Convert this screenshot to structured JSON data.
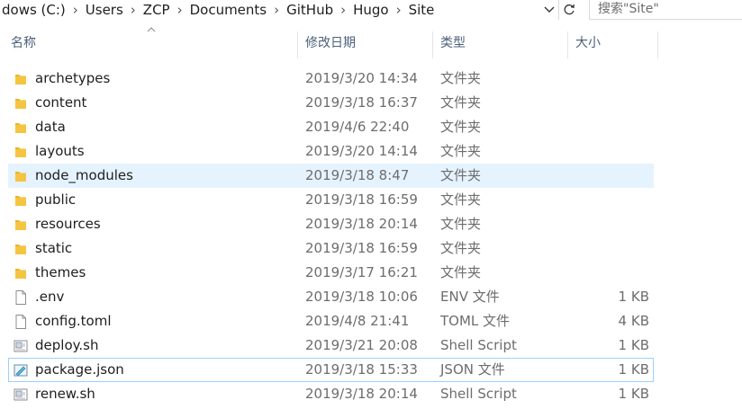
{
  "address": {
    "crumbs": [
      "dows (C:)",
      "Users",
      "ZCP",
      "Documents",
      "GitHub",
      "Hugo",
      "Site"
    ]
  },
  "search": {
    "placeholder": "搜索\"Site\""
  },
  "columns": {
    "name": "名称",
    "modified": "修改日期",
    "type": "类型",
    "size": "大小"
  },
  "files": [
    {
      "name": "archetypes",
      "date": "2019/3/20 14:34",
      "type": "文件夹",
      "size": "",
      "icon": "folder-icon"
    },
    {
      "name": "content",
      "date": "2019/3/18 16:37",
      "type": "文件夹",
      "size": "",
      "icon": "folder-icon"
    },
    {
      "name": "data",
      "date": "2019/4/6 22:40",
      "type": "文件夹",
      "size": "",
      "icon": "folder-icon"
    },
    {
      "name": "layouts",
      "date": "2019/3/20 14:14",
      "type": "文件夹",
      "size": "",
      "icon": "folder-icon"
    },
    {
      "name": "node_modules",
      "date": "2019/3/18 8:47",
      "type": "文件夹",
      "size": "",
      "icon": "folder-icon",
      "state": "hover"
    },
    {
      "name": "public",
      "date": "2019/3/18 16:59",
      "type": "文件夹",
      "size": "",
      "icon": "folder-icon"
    },
    {
      "name": "resources",
      "date": "2019/3/18 20:14",
      "type": "文件夹",
      "size": "",
      "icon": "folder-icon"
    },
    {
      "name": "static",
      "date": "2019/3/18 16:59",
      "type": "文件夹",
      "size": "",
      "icon": "folder-icon"
    },
    {
      "name": "themes",
      "date": "2019/3/17 16:21",
      "type": "文件夹",
      "size": "",
      "icon": "folder-icon"
    },
    {
      "name": ".env",
      "date": "2019/3/18 10:06",
      "type": "ENV 文件",
      "size": "1 KB",
      "icon": "file-icon"
    },
    {
      "name": "config.toml",
      "date": "2019/4/8 21:41",
      "type": "TOML 文件",
      "size": "4 KB",
      "icon": "file-icon"
    },
    {
      "name": "deploy.sh",
      "date": "2019/3/21 20:08",
      "type": "Shell Script",
      "size": "1 KB",
      "icon": "shell-script-icon"
    },
    {
      "name": "package.json",
      "date": "2019/3/18 15:33",
      "type": "JSON 文件",
      "size": "1 KB",
      "icon": "json-file-icon",
      "state": "focus"
    },
    {
      "name": "renew.sh",
      "date": "2019/3/18 20:14",
      "type": "Shell Script",
      "size": "1 KB",
      "icon": "shell-script-icon"
    }
  ],
  "colors": {
    "header_text": "#4c607a",
    "hover_bg": "#e5f3ff",
    "focus_border": "#99d1ff",
    "folder": "#f5c542"
  }
}
